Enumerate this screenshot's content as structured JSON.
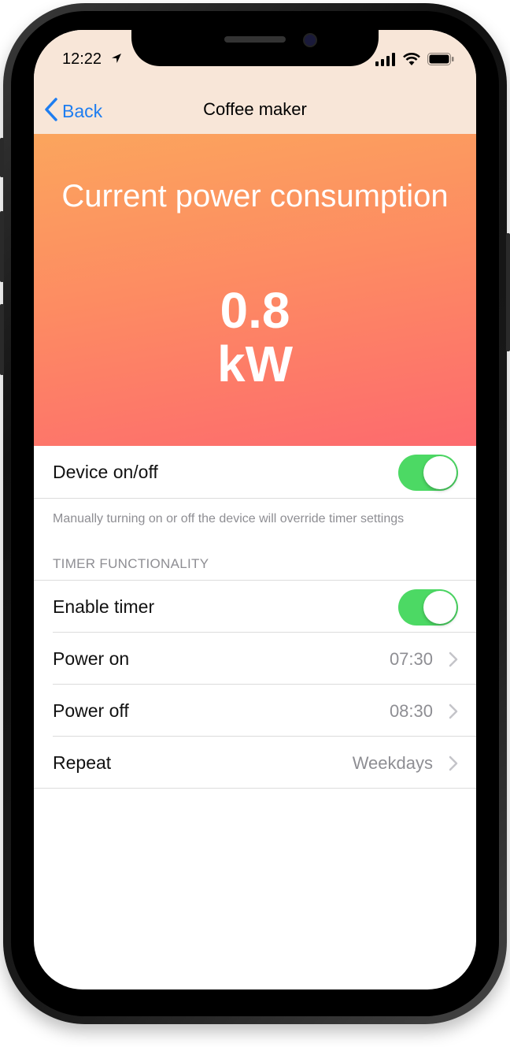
{
  "status_bar": {
    "time": "12:22"
  },
  "nav": {
    "back_label": "Back",
    "title": "Coffee maker"
  },
  "hero": {
    "title": "Current power consumption",
    "value": "0.8",
    "unit": "kW",
    "gradient_colors": [
      "#fba55d",
      "#fd6a6e"
    ]
  },
  "device_toggle": {
    "label": "Device on/off",
    "on": true
  },
  "footnote": "Manually turning on or off the device will override timer settings",
  "timer_section": {
    "header": "TIMER FUNCTIONALITY",
    "enable": {
      "label": "Enable timer",
      "on": true
    },
    "rows": [
      {
        "label": "Power on",
        "value": "07:30"
      },
      {
        "label": "Power off",
        "value": "08:30"
      },
      {
        "label": "Repeat",
        "value": "Weekdays"
      }
    ]
  },
  "colors": {
    "accent_blue": "#1e7df0",
    "toggle_green": "#4cd964",
    "header_bg": "#f8e6d8"
  }
}
